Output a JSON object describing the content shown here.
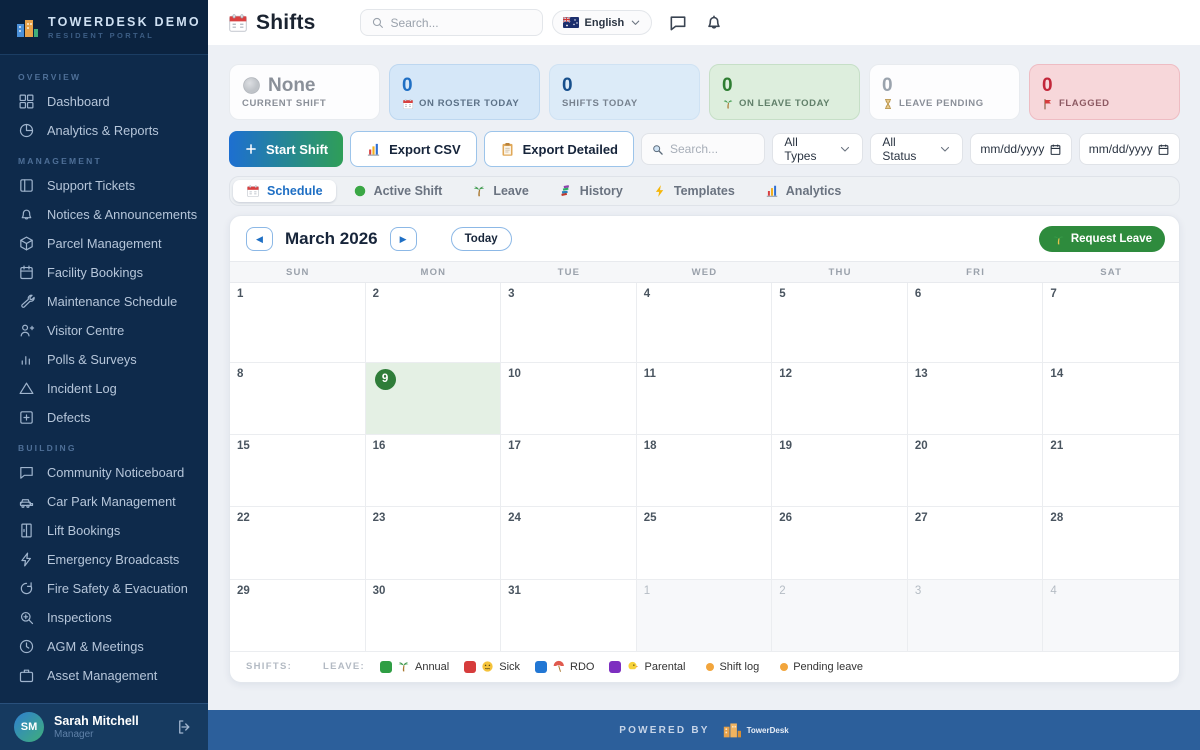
{
  "brand": {
    "title": "TOWERDESK DEMO",
    "subtitle": "RESIDENT PORTAL"
  },
  "sidebar": {
    "sections": [
      {
        "label": "OVERVIEW",
        "items": [
          {
            "label": "Dashboard",
            "icon": "dashboard-grid"
          },
          {
            "label": "Analytics & Reports",
            "icon": "pie-chart"
          }
        ]
      },
      {
        "label": "MANAGEMENT",
        "items": [
          {
            "label": "Support Tickets",
            "icon": "ticket"
          },
          {
            "label": "Notices & Announcements",
            "icon": "bell-outline"
          },
          {
            "label": "Parcel Management",
            "icon": "package-box"
          },
          {
            "label": "Facility Bookings",
            "icon": "calendar-outline"
          },
          {
            "label": "Maintenance Schedule",
            "icon": "wrench"
          },
          {
            "label": "Visitor Centre",
            "icon": "user-plus"
          },
          {
            "label": "Polls & Surveys",
            "icon": "bar-chart"
          },
          {
            "label": "Incident Log",
            "icon": "warning-triangle"
          },
          {
            "label": "Defects",
            "icon": "grid-plus"
          }
        ]
      },
      {
        "label": "BUILDING",
        "items": [
          {
            "label": "Community Noticeboard",
            "icon": "speech-bubble"
          },
          {
            "label": "Car Park Management",
            "icon": "car"
          },
          {
            "label": "Lift Bookings",
            "icon": "lift-door"
          },
          {
            "label": "Emergency Broadcasts",
            "icon": "lightning"
          },
          {
            "label": "Fire Safety & Evacuation",
            "icon": "fire-safety"
          },
          {
            "label": "Inspections",
            "icon": "magnifier-plus"
          },
          {
            "label": "AGM & Meetings",
            "icon": "clock"
          },
          {
            "label": "Asset Management",
            "icon": "briefcase"
          }
        ]
      }
    ],
    "user": {
      "initials": "SM",
      "name": "Sarah Mitchell",
      "role": "Manager"
    }
  },
  "header": {
    "title": "Shifts",
    "search_placeholder": "Search...",
    "language": "English"
  },
  "stats": [
    {
      "value": "None",
      "label": "CURRENT SHIFT",
      "variant": "none",
      "value_icon": "gray-circle"
    },
    {
      "value": "0",
      "label": "ON ROSTER TODAY",
      "variant": "blue",
      "label_icon": "calendar-red"
    },
    {
      "value": "0",
      "label": "SHIFTS TODAY",
      "variant": "bluelight"
    },
    {
      "value": "0",
      "label": "ON LEAVE TODAY",
      "variant": "green",
      "label_icon": "palm"
    },
    {
      "value": "0",
      "label": "LEAVE PENDING",
      "variant": "plain",
      "label_icon": "hourglass"
    },
    {
      "value": "0",
      "label": "FLAGGED",
      "variant": "red",
      "label_icon": "flag-red"
    }
  ],
  "toolbar": {
    "start_shift": "Start Shift",
    "export_csv": "Export CSV",
    "export_detailed": "Export Detailed",
    "search_placeholder": "Search...",
    "type_filter": "All Types",
    "status_filter": "All Status",
    "date_from": "mm/dd/yyyy",
    "date_to": "mm/dd/yyyy"
  },
  "tabs": [
    {
      "label": "Schedule",
      "icon": "calendar-red",
      "active": true
    },
    {
      "label": "Active Shift",
      "icon": "green-dot",
      "active": false
    },
    {
      "label": "Leave",
      "icon": "palm",
      "active": false
    },
    {
      "label": "History",
      "icon": "books",
      "active": false
    },
    {
      "label": "Templates",
      "icon": "bolt-yellow",
      "active": false
    },
    {
      "label": "Analytics",
      "icon": "chart-colored",
      "active": false
    }
  ],
  "calendar": {
    "month_label": "March 2026",
    "today_label": "Today",
    "request_leave_label": "Request Leave",
    "day_headers": [
      "SUN",
      "MON",
      "TUE",
      "WED",
      "THU",
      "FRI",
      "SAT"
    ],
    "weeks": [
      [
        {
          "d": "1"
        },
        {
          "d": "2"
        },
        {
          "d": "3"
        },
        {
          "d": "4"
        },
        {
          "d": "5"
        },
        {
          "d": "6"
        },
        {
          "d": "7"
        }
      ],
      [
        {
          "d": "8"
        },
        {
          "d": "9",
          "today": true
        },
        {
          "d": "10"
        },
        {
          "d": "11"
        },
        {
          "d": "12"
        },
        {
          "d": "13"
        },
        {
          "d": "14"
        }
      ],
      [
        {
          "d": "15"
        },
        {
          "d": "16"
        },
        {
          "d": "17"
        },
        {
          "d": "18"
        },
        {
          "d": "19"
        },
        {
          "d": "20"
        },
        {
          "d": "21"
        }
      ],
      [
        {
          "d": "22"
        },
        {
          "d": "23"
        },
        {
          "d": "24"
        },
        {
          "d": "25"
        },
        {
          "d": "26"
        },
        {
          "d": "27"
        },
        {
          "d": "28"
        }
      ],
      [
        {
          "d": "29"
        },
        {
          "d": "30"
        },
        {
          "d": "31"
        },
        {
          "d": "1",
          "muted": true
        },
        {
          "d": "2",
          "muted": true
        },
        {
          "d": "3",
          "muted": true
        },
        {
          "d": "4",
          "muted": true
        }
      ]
    ]
  },
  "legend": {
    "shifts_label": "SHIFTS:",
    "leave_label": "LEAVE:",
    "leave_types": [
      {
        "color": "#2f9e44",
        "icon": "palm",
        "label": "Annual"
      },
      {
        "color": "#d63c3c",
        "icon": "sick-face",
        "label": "Sick"
      },
      {
        "color": "#2277d4",
        "icon": "umbrella",
        "label": "RDO"
      },
      {
        "color": "#7d2fc0",
        "icon": "chick",
        "label": "Parental"
      }
    ],
    "log_types": [
      {
        "color": "#f2a53c",
        "label": "Shift log"
      },
      {
        "color": "#f2a53c",
        "label": "Pending leave"
      }
    ]
  },
  "footer": {
    "powered_by": "POWERED BY",
    "logo_text": "TowerDesk"
  },
  "colors": {
    "accent_blue": "#1f6fc4",
    "accent_green": "#2e8b3d",
    "sidebar_bg": "#0e2a4b",
    "footer_bg": "#2c5f9b"
  }
}
